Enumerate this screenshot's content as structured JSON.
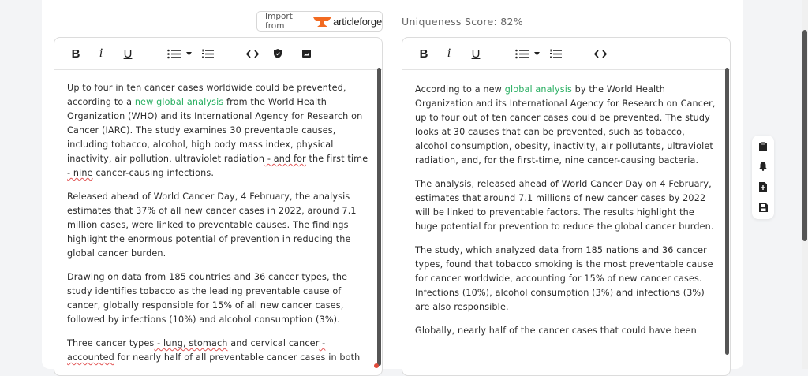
{
  "import": {
    "label": "Import from",
    "brand": "articleforge"
  },
  "score": {
    "text": "Uniqueness Score: 82%"
  },
  "toolbar_left": {
    "bold": "B",
    "italic": "i",
    "underline": "U",
    "icons": [
      "bulleted-list-icon",
      "caret-down-icon",
      "numbered-list-icon",
      "code-icon",
      "shield-icon",
      "image-icon"
    ]
  },
  "toolbar_right": {
    "bold": "B",
    "italic": "i",
    "underline": "U",
    "icons": [
      "bulleted-list-icon",
      "caret-down-icon",
      "numbered-list-icon",
      "code-icon"
    ]
  },
  "left": {
    "p1": {
      "a": "Up to four in ten cancer cases worldwide could be prevented, according to a ",
      "link": "new global analysis",
      "b": " from the World Health Organization (WHO) and its International Agency for Research on Cancer (IARC). The study examines 30 preventable causes, including tobacco, alcohol, high body mass index, physical inactivity, air pollution, ultraviolet radiation",
      "sq": " - and for",
      "c": " the first time ",
      "sq2": "- nine",
      "d": " cancer-causing infections."
    },
    "p2": "Released ahead of World Cancer Day, 4 February, the analysis estimates that 37% of all new cancer cases in 2022, around 7.1 million cases, were linked to preventable causes. The findings highlight the enormous potential of prevention in reducing the global cancer burden.",
    "p3": "Drawing on data from 185 countries and 36 cancer types, the study identifies tobacco as the leading preventable cause of cancer, globally responsible for 15% of all new cancer cases, followed by infections (10%) and alcohol consumption (3%).",
    "p4": {
      "a": "Three cancer types",
      "sq": " - lung, stomach",
      "b": " and cervical cancer",
      "sq2": " - accounted",
      "c": " for nearly half of all preventable cancer cases in both"
    }
  },
  "right": {
    "p1": {
      "a": "According to a new ",
      "link": "global analysis",
      "b": " by the World Health Organization and its International Agency for Research on Cancer, up to four out of ten cancer cases could be prevented. The study looks at 30 causes that can be prevented, such as tobacco, alcohol consumption, obesity, inactivity, air pollutants, ultraviolet radiation, and, for the first-time, nine cancer-causing bacteria."
    },
    "p2": "The analysis, released ahead of World Cancer Day on 4 February, estimates that around 7.1 millions of new cancer cases by 2022 will be linked to preventable factors. The results highlight the huge potential for prevention to reduce the global cancer burden.",
    "p3": "The study, which analyzed data from 185 nations and 36 cancer types, found that tobacco smoking is the most preventable cause for cancer worldwide, accounting for 15% of new cancer cases. Infections (10%), alcohol consumption (3%) and infections (3%) are also responsible.",
    "p4": "Globally, nearly half of the cancer cases that could have been"
  },
  "side_tools": [
    "clipboard-icon",
    "bell-icon",
    "add-document-icon",
    "save-icon"
  ],
  "colors": {
    "accent": "#27ae60",
    "brand_orange": "#f26a21",
    "spell_error": "#e25555"
  }
}
